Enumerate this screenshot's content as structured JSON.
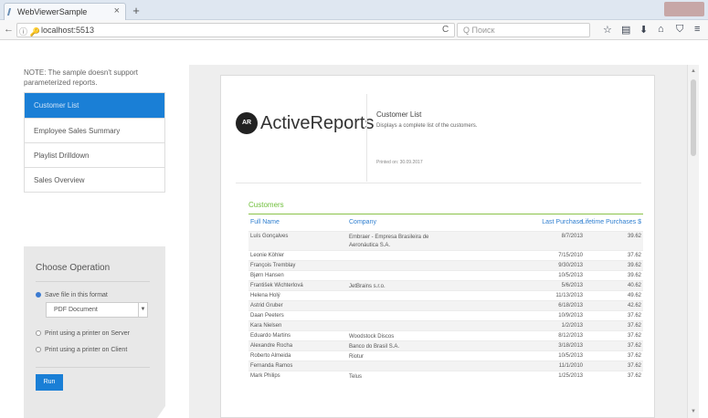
{
  "browser": {
    "tab_title": "WebViewerSample",
    "tab_close": "×",
    "new_tab": "+",
    "url_security": "ⓘ 🔑",
    "url": "localhost:5513",
    "reload": "C",
    "search_placeholder": "Q Поиск",
    "back": "←"
  },
  "sidebar": {
    "note": "NOTE: The sample doesn't support parameterized reports.",
    "reports": [
      {
        "label": "Customer List",
        "active": true
      },
      {
        "label": "Employee Sales Summary",
        "active": false
      },
      {
        "label": "Playlist Drilldown",
        "active": false
      },
      {
        "label": "Sales Overview",
        "active": false
      }
    ]
  },
  "operation": {
    "title": "Choose Operation",
    "option_save": "Save file in this format",
    "format_selected": "PDF Document",
    "option_print_server": "Print using a printer on Server",
    "option_print_client": "Print using a printer on Client",
    "run_label": "Run"
  },
  "report": {
    "logo_mark": "AR",
    "logo_text": "ActiveReports",
    "title": "Customer List",
    "description": "Displays a complete list of the customers.",
    "printed_on": "Printed on: 30.09.2017",
    "section_label": "Customers",
    "columns": [
      "Full Name",
      "Company",
      "Last Purchase",
      "Lifetime Purchases $"
    ],
    "rows": [
      [
        "Luís Gonçalves",
        "Embraer - Empresa Brasileira de Aeronáutica S.A.",
        "8/7/2013",
        "39.62"
      ],
      [
        "Leonie Köhler",
        "",
        "7/15/2010",
        "37.62"
      ],
      [
        "François Tremblay",
        "",
        "9/30/2013",
        "39.62"
      ],
      [
        "Bjørn Hansen",
        "",
        "10/5/2013",
        "39.62"
      ],
      [
        "František Wichterlová",
        "JetBrains s.r.o.",
        "5/6/2013",
        "40.62"
      ],
      [
        "Helena Holý",
        "",
        "11/13/2013",
        "49.62"
      ],
      [
        "Astrid Gruber",
        "",
        "6/18/2013",
        "42.62"
      ],
      [
        "Daan Peeters",
        "",
        "10/9/2013",
        "37.62"
      ],
      [
        "Kara Nielsen",
        "",
        "1/2/2013",
        "37.62"
      ],
      [
        "Eduardo Martins",
        "Woodstock Discos",
        "8/12/2013",
        "37.62"
      ],
      [
        "Alexandre Rocha",
        "Banco do Brasil S.A.",
        "3/18/2013",
        "37.62"
      ],
      [
        "Roberto Almeida",
        "Riotur",
        "10/5/2013",
        "37.62"
      ],
      [
        "Fernanda Ramos",
        "",
        "11/1/2010",
        "37.62"
      ],
      [
        "Mark Philips",
        "Telus",
        "1/25/2013",
        "37.62"
      ]
    ]
  }
}
